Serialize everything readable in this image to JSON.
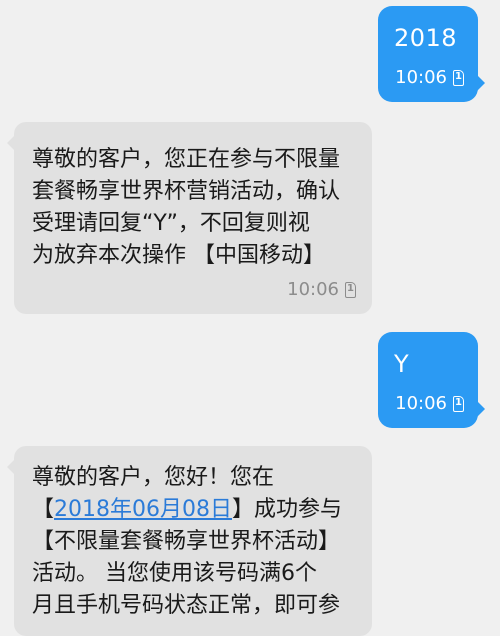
{
  "messages": [
    {
      "direction": "out",
      "text": "2018",
      "time": "10:06",
      "sim": "1"
    },
    {
      "direction": "in",
      "lines": [
        "尊敬的客户，您正在参与不限量",
        "套餐畅享世界杯营销活动，确认",
        "受理请回复“Y”，不回复则视",
        "为放弃本次操作 【中国移动】"
      ],
      "time": "10:06",
      "sim": "1"
    },
    {
      "direction": "out",
      "text": "Y",
      "time": "10:06",
      "sim": "1"
    },
    {
      "direction": "in",
      "line1": "尊敬的客户，您好！您在",
      "line2_prefix": "【",
      "line2_link": "2018年06月08日",
      "line2_suffix": "】成功参与",
      "line3": "【不限量套餐畅享世界杯活动】",
      "line4": "活动。 当您使用该号码满6个",
      "line5": "月且手机号码状态正常，即可参"
    }
  ],
  "colors": {
    "outgoing_bubble": "#2b9af3",
    "incoming_bubble": "#e1e1e1",
    "background": "#f0f0f0",
    "link": "#2b7bd8"
  },
  "icons": {
    "sim": "sim-card-icon"
  }
}
